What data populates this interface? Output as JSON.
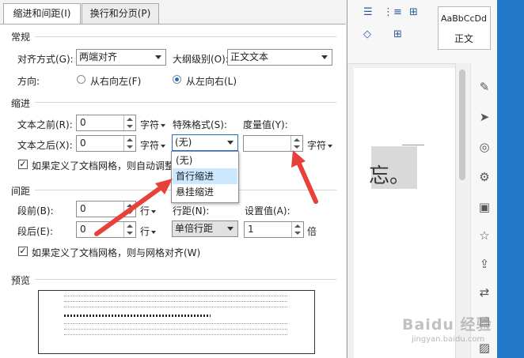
{
  "dialog": {
    "tabs": [
      {
        "label": "缩进和间距(I)"
      },
      {
        "label": "换行和分页(P)"
      }
    ],
    "general": {
      "section": "常规",
      "align_label": "对齐方式(G):",
      "align_value": "两端对齐",
      "outline_label": "大纲级别(O):",
      "outline_value": "正文文本",
      "direction_label": "方向:",
      "rtl_label": "从右向左(F)",
      "ltr_label": "从左向右(L)"
    },
    "indent": {
      "section": "缩进",
      "before_label": "文本之前(R):",
      "before_value": "0",
      "before_unit": "字符",
      "after_label": "文本之后(X):",
      "after_value": "0",
      "after_unit": "字符",
      "special_label": "特殊格式(S):",
      "special_value": "(无)",
      "measure_label": "度量值(Y):",
      "measure_value": "",
      "measure_unit": "字符",
      "grid_check_label": "如果定义了文档网格，则自动调整"
    },
    "special_dropdown": [
      "(无)",
      "首行缩进",
      "悬挂缩进"
    ],
    "spacing": {
      "section": "间距",
      "before_label": "段前(B):",
      "before_value": "0",
      "before_unit": "行",
      "after_label": "段后(E):",
      "after_value": "0",
      "after_unit": "行",
      "line_label": "行距(N):",
      "line_value": "单倍行距",
      "set_label": "设置值(A):",
      "set_value": "1",
      "set_unit": "倍",
      "grid_check_label": "如果定义了文档网格，则与网格对齐(W)"
    },
    "preview": {
      "section": "预览"
    }
  },
  "document": {
    "style_sample": "AaBbCcDd",
    "style_name": "正文",
    "page_text": "忘。"
  },
  "watermark": {
    "brand": "Baidu 经验",
    "url": "jingyan.baidu.com"
  },
  "colors": {
    "accent": "#1f6fd1",
    "arrow": "#e8413a",
    "highlight": "#cce8ff",
    "sidebar_blue": "#2277c9"
  }
}
